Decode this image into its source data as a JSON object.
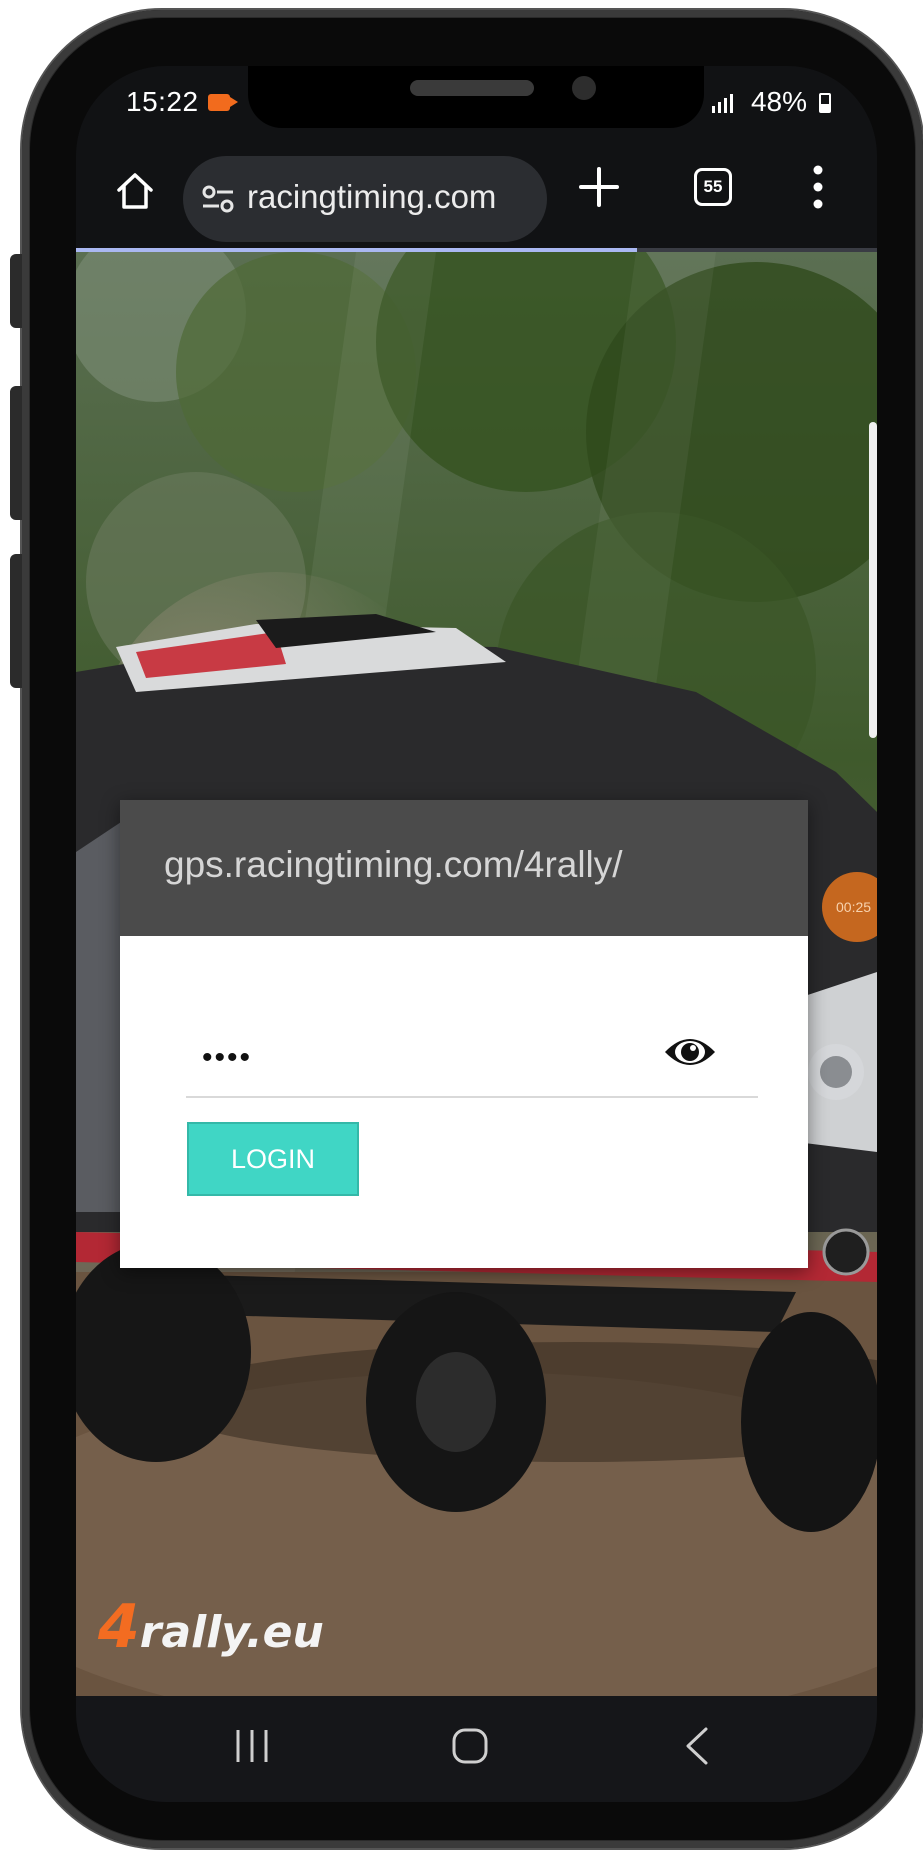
{
  "status_bar": {
    "time": "15:22",
    "battery": "48%",
    "icons": [
      "screen-record-icon",
      "signal-icon",
      "battery-icon"
    ]
  },
  "browser": {
    "url": "racingtiming.com",
    "tab_count": "55",
    "load_progress": 0.7,
    "icons": [
      "home-icon",
      "site-settings-icon",
      "new-tab-icon",
      "tab-switcher-icon",
      "menu-icon"
    ]
  },
  "login": {
    "header": "gps.racingtiming.com/4rally/",
    "password_value": "••••",
    "button_label": "LOGIN",
    "colors": {
      "header_bg": "#4b4b4b",
      "button_bg": "#40d6c5"
    }
  },
  "overlay": {
    "timer_text": "00:25"
  },
  "brand": {
    "logo_prefix": "4",
    "logo_rest": "rally.eu"
  },
  "nav_bar": {
    "icons": [
      "recents-icon",
      "home-nav-icon",
      "back-icon"
    ]
  }
}
